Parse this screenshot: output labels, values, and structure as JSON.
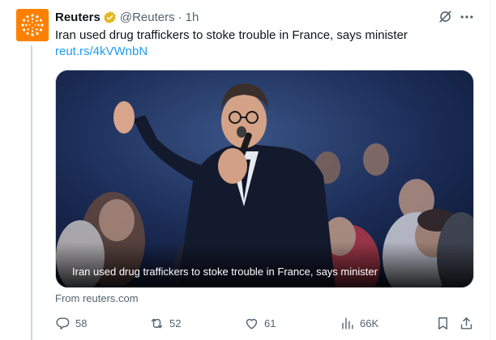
{
  "tweet": {
    "author_name": "Reuters",
    "author_handle": "@Reuters",
    "separator": "·",
    "timestamp": "1h",
    "text": "Iran used drug traffickers to stoke trouble in France, says minister",
    "link_text": "reut.rs/4kVWnbN",
    "media_caption": "Iran used drug traffickers to stoke trouble in France, says minister",
    "source_text": "From reuters.com"
  },
  "actions": {
    "replies": "58",
    "reposts": "52",
    "likes": "61",
    "views": "66K"
  },
  "icons": {
    "avatar": "reuters-logo",
    "verified": "verified-badge-icon",
    "grok": "grok-icon",
    "more": "more-icon",
    "reply": "reply-icon",
    "repost": "repost-icon",
    "like": "heart-icon",
    "views": "views-bar-icon",
    "bookmark": "bookmark-icon",
    "share": "share-icon"
  },
  "colors": {
    "brand_orange": "#ff8000",
    "verified_gold": "#e2b719",
    "link_blue": "#1d9bf0",
    "muted_text": "#536471",
    "primary_text": "#0f1419"
  }
}
